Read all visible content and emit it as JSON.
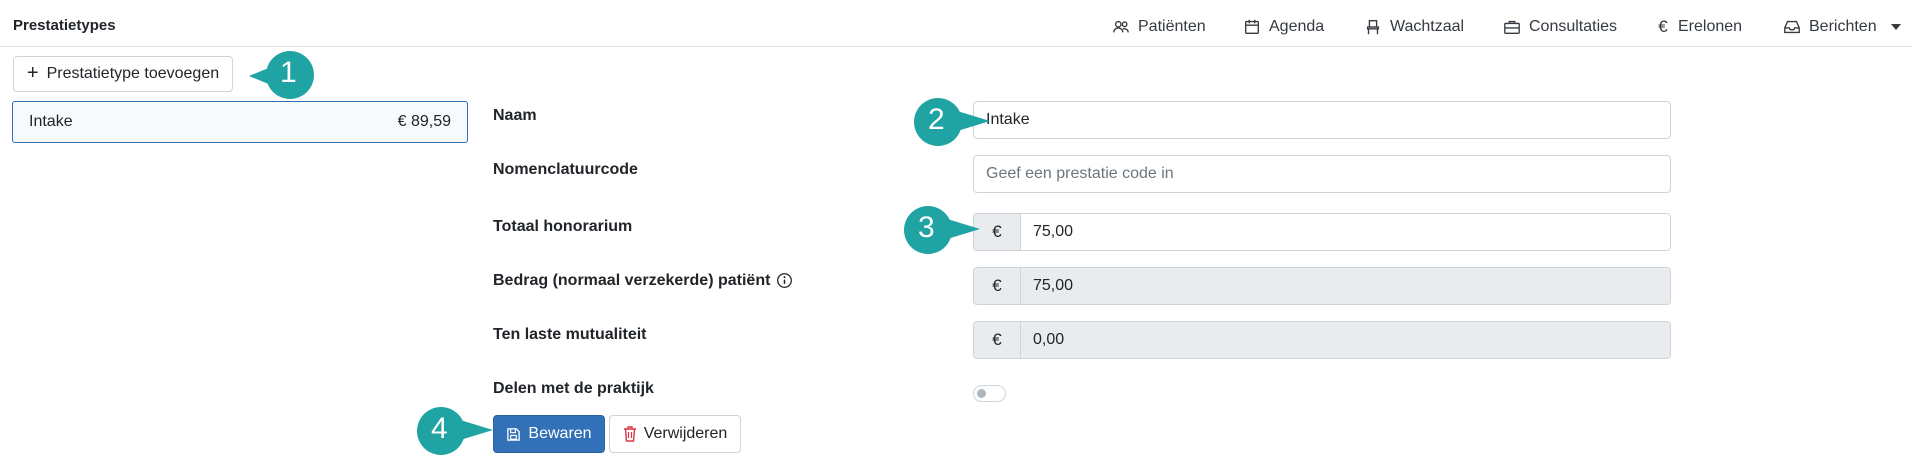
{
  "header": {
    "title": "Prestatietypes",
    "nav": [
      {
        "label": "Patiënten",
        "icon": "users-icon"
      },
      {
        "label": "Agenda",
        "icon": "calendar-icon"
      },
      {
        "label": "Wachtzaal",
        "icon": "chair-icon"
      },
      {
        "label": "Consultaties",
        "icon": "briefcase-icon"
      },
      {
        "label": "Erelonen",
        "icon": "euro-icon"
      },
      {
        "label": "Berichten",
        "icon": "inbox-icon"
      }
    ]
  },
  "sidebar": {
    "add_button_label": "Prestatietype toevoegen",
    "items": [
      {
        "name": "Intake",
        "price": "€ 89,59"
      }
    ]
  },
  "form": {
    "naam": {
      "label": "Naam",
      "value": "Intake"
    },
    "nomenclatuurcode": {
      "label": "Nomenclatuurcode",
      "value": "",
      "placeholder": "Geef een prestatie code in"
    },
    "totaal_honorarium": {
      "label": "Totaal honorarium",
      "currency": "€",
      "value": "75,00"
    },
    "bedrag_patient": {
      "label": "Bedrag (normaal verzekerde) patiënt",
      "currency": "€",
      "value": "75,00"
    },
    "ten_laste": {
      "label": "Ten laste mutualiteit",
      "currency": "€",
      "value": "0,00"
    },
    "delen": {
      "label": "Delen met de praktijk",
      "checked": false
    }
  },
  "actions": {
    "save_label": "Bewaren",
    "delete_label": "Verwijderen"
  },
  "callouts": [
    "1",
    "2",
    "3",
    "4"
  ],
  "colors": {
    "primary": "#3271b7",
    "callout": "#1fa3a3",
    "danger": "#dc3545",
    "border": "#ced4da"
  }
}
